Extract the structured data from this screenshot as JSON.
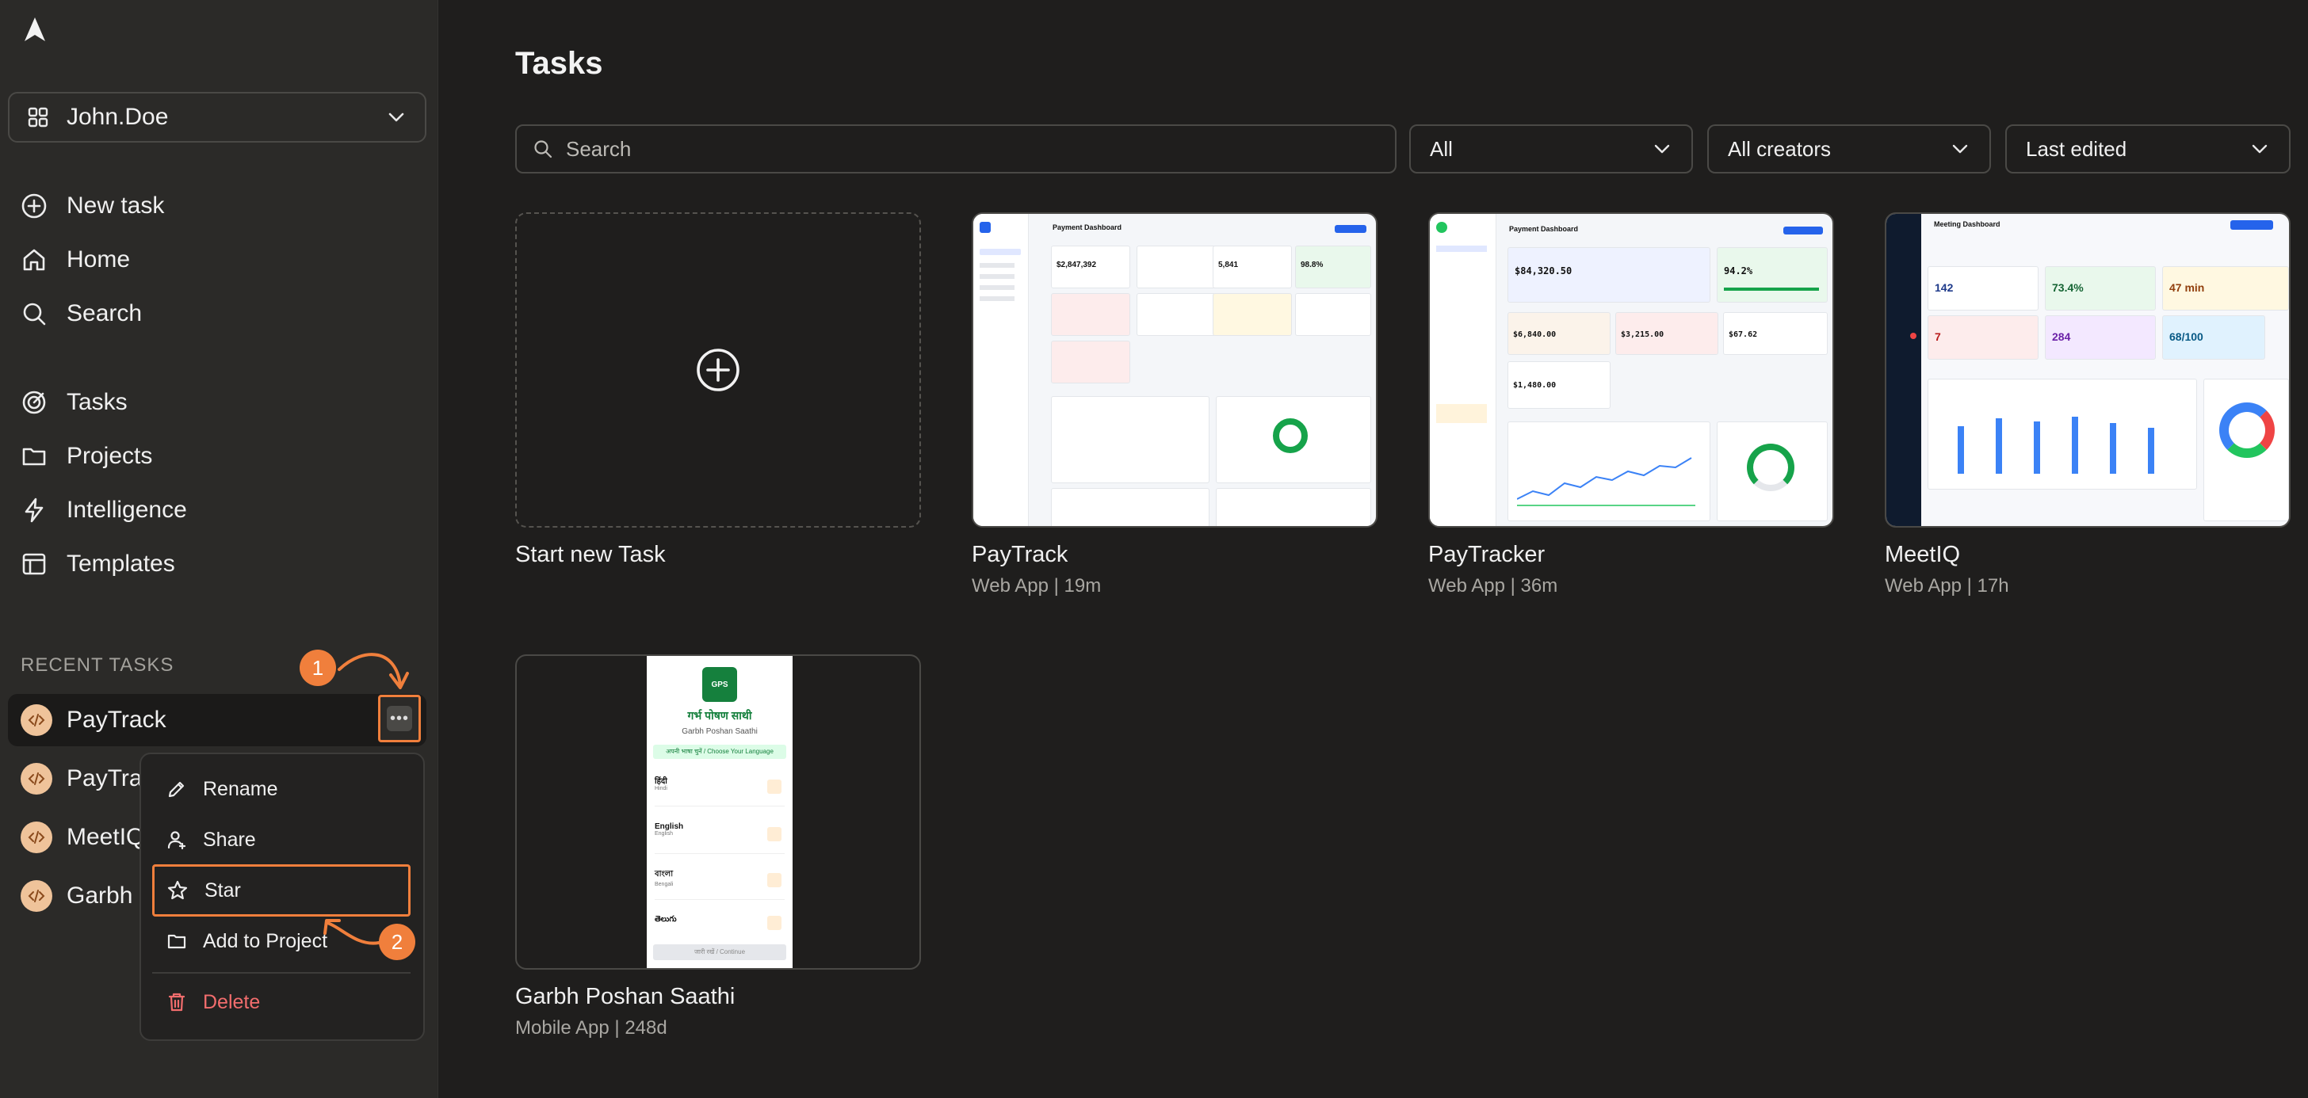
{
  "sidebar": {
    "workspace": "John.Doe",
    "nav": [
      {
        "label": "New task",
        "icon": "plus-circle-icon"
      },
      {
        "label": "Home",
        "icon": "home-icon"
      },
      {
        "label": "Search",
        "icon": "search-icon"
      },
      {
        "label": "Tasks",
        "icon": "target-icon"
      },
      {
        "label": "Projects",
        "icon": "folder-icon"
      },
      {
        "label": "Intelligence",
        "icon": "bolt-icon"
      },
      {
        "label": "Templates",
        "icon": "layout-icon"
      }
    ],
    "recent_label": "RECENT TASKS",
    "recent": [
      {
        "label": "PayTrack"
      },
      {
        "label": "PayTrac"
      },
      {
        "label": "MeetIQ"
      },
      {
        "label": "Garbh I"
      }
    ]
  },
  "context_menu": {
    "items": [
      {
        "label": "Rename",
        "icon": "pencil-icon"
      },
      {
        "label": "Share",
        "icon": "share-user-icon"
      },
      {
        "label": "Star",
        "icon": "star-icon"
      },
      {
        "label": "Add to Project",
        "icon": "folder-icon"
      },
      {
        "label": "Delete",
        "icon": "trash-icon"
      }
    ]
  },
  "annotations": {
    "step1": "1",
    "step2": "2"
  },
  "main": {
    "title": "Tasks",
    "search_placeholder": "Search",
    "filters": {
      "type": "All",
      "creators": "All creators",
      "sort": "Last edited"
    },
    "new_task_label": "Start new Task",
    "cards": [
      {
        "title": "PayTrack",
        "subtitle": "Web App | 19m"
      },
      {
        "title": "PayTracker",
        "subtitle": "Web App | 36m"
      },
      {
        "title": "MeetIQ",
        "subtitle": "Web App | 17h"
      },
      {
        "title": "Garbh Poshan Saathi",
        "subtitle": "Mobile App | 248d"
      }
    ],
    "garbh_preview": {
      "logo_text": "GPS",
      "app_name": "गर्भ पोषण साथी",
      "app_name_en": "Garbh Poshan Saathi",
      "choose_language": "अपनी भाषा चुनें / Choose Your Language",
      "languages": [
        {
          "native": "हिंदी",
          "english": "Hindi"
        },
        {
          "native": "English",
          "english": "English"
        },
        {
          "native": "বাংলা",
          "english": "Bengali"
        },
        {
          "native": "తెలుగు",
          "english": ""
        }
      ],
      "continue_label": "जारी रखें / Continue"
    },
    "paytrack_preview": {
      "heading": "Payment Dashboard",
      "value1": "$2,847,392",
      "value2": "5,841",
      "value3": "98.8%"
    },
    "paytracker_preview": {
      "heading": "Payment Dashboard",
      "value1": "$84,320.50",
      "value2": "94.2%",
      "value3": "$6,840.00",
      "value4": "$3,215.00",
      "value5": "$67.62",
      "value6": "$1,480.00"
    },
    "meetiq_preview": {
      "heading": "Meeting Dashboard",
      "value1": "142",
      "value2": "73.4%",
      "value3": "47 min",
      "value4": "7",
      "value5": "284",
      "value6": "68/100"
    }
  },
  "colors": {
    "accent": "#f07f3c",
    "delete": "#f26d6d",
    "badge": "#efc39a"
  }
}
